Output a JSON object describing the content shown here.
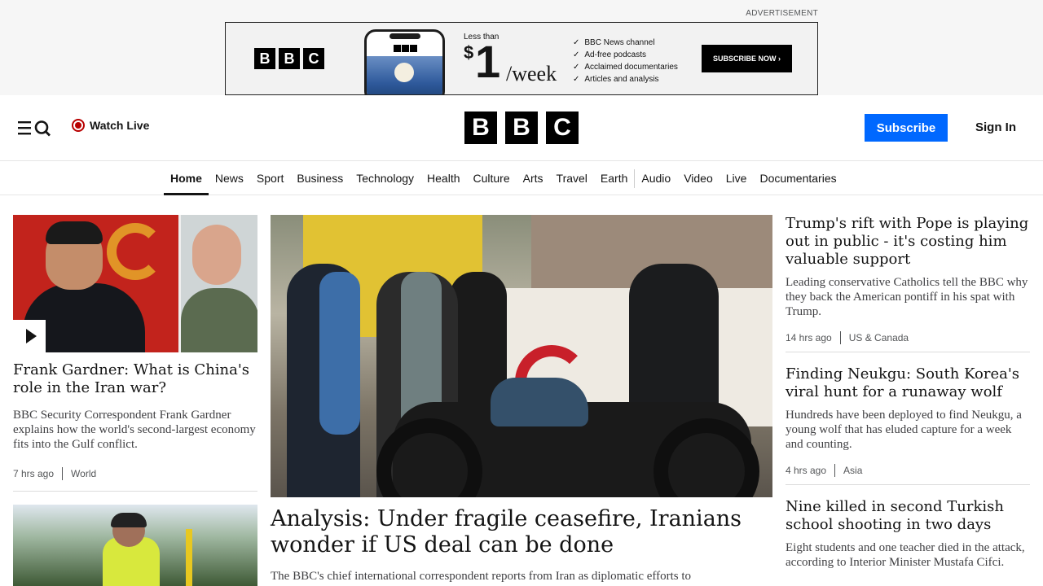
{
  "ad": {
    "label": "ADVERTISEMENT",
    "logo_letters": [
      "B",
      "B",
      "C"
    ],
    "less_than": "Less than",
    "currency": "$",
    "price": "1",
    "per": "/week",
    "features": [
      "BBC News channel",
      "Ad-free podcasts",
      "Acclaimed documentaries",
      "Articles and analysis"
    ],
    "cta": "SUBSCRIBE NOW ›"
  },
  "header": {
    "watch_live": "Watch Live",
    "logo_letters": [
      "B",
      "B",
      "C"
    ],
    "subscribe": "Subscribe",
    "sign_in": "Sign In"
  },
  "nav": {
    "items": [
      "Home",
      "News",
      "Sport",
      "Business",
      "Technology",
      "Health",
      "Culture",
      "Arts",
      "Travel",
      "Earth",
      "Audio",
      "Video",
      "Live",
      "Documentaries"
    ],
    "active": "Home"
  },
  "stories": {
    "left1": {
      "headline": "Frank Gardner: What is China's role in the Iran war?",
      "summary": "BBC Security Correspondent Frank Gardner explains how the world's second-largest economy fits into the Gulf conflict.",
      "time": "7 hrs ago",
      "section": "World"
    },
    "main": {
      "headline": "Analysis: Under fragile ceasefire, Iranians wonder if US deal can be done",
      "summary": "The BBC's chief international correspondent reports from Iran as diplomatic efforts to"
    },
    "right1": {
      "headline": "Trump's rift with Pope is playing out in public - it's costing him valuable support",
      "summary": "Leading conservative Catholics tell the BBC why they back the American pontiff in his spat with Trump.",
      "time": "14 hrs ago",
      "section": "US & Canada"
    },
    "right2": {
      "headline": "Finding Neukgu: South Korea's viral hunt for a runaway wolf",
      "summary": "Hundreds have been deployed to find Neukgu, a young wolf that has eluded capture for a week and counting.",
      "time": "4 hrs ago",
      "section": "Asia"
    },
    "right3": {
      "headline": "Nine killed in second Turkish school shooting in two days",
      "summary": "Eight students and one teacher died in the attack, according to Interior Minister Mustafa Cifci."
    }
  },
  "colors": {
    "subscribe_bg": "#0068ff",
    "live_red": "#b80000"
  }
}
